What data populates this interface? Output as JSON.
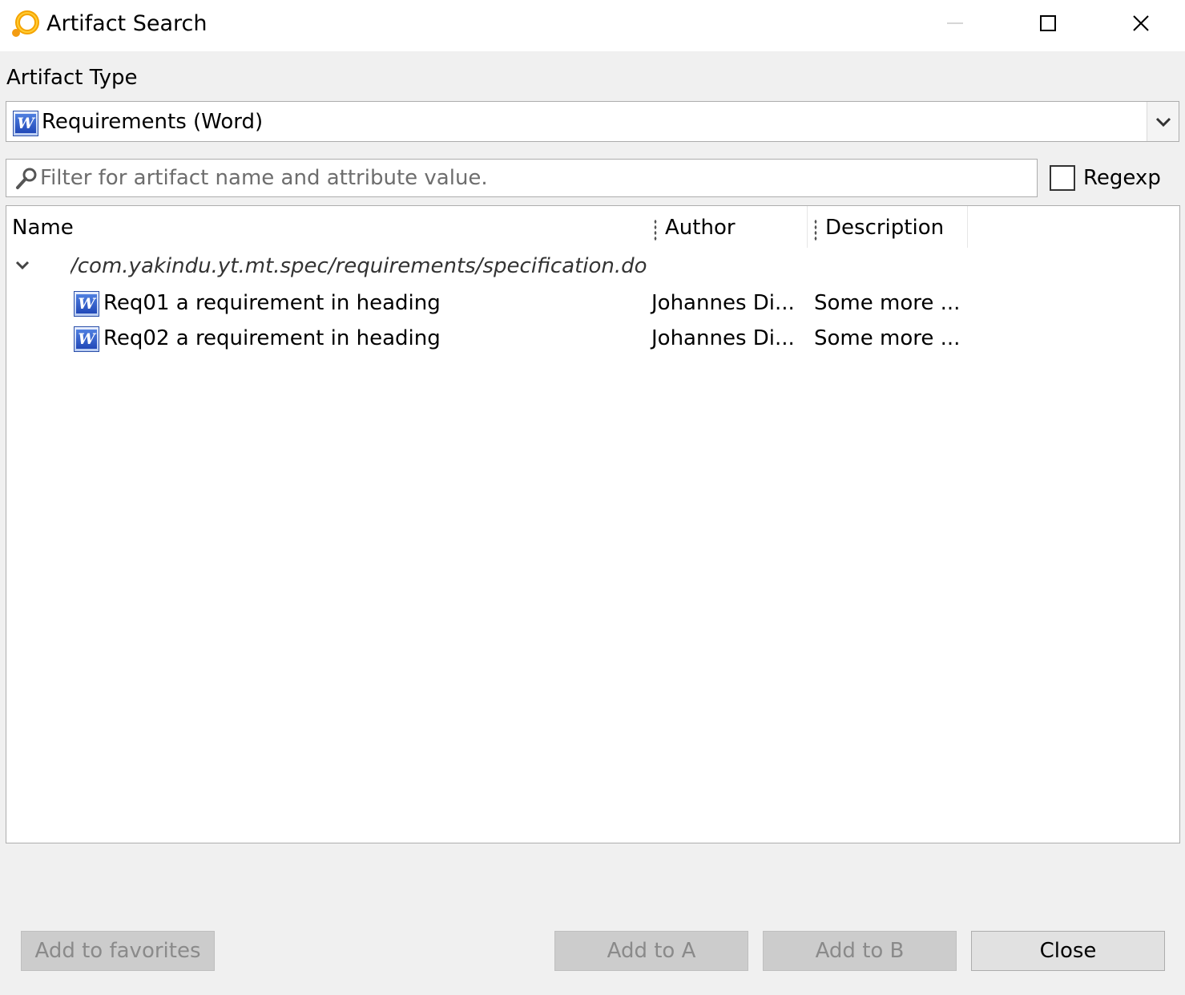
{
  "window": {
    "title": "Artifact Search",
    "icon": "yakindu-traceability-icon"
  },
  "artifact_type": {
    "label": "Artifact Type",
    "selected": "Requirements (Word)",
    "icon": "word-document-icon"
  },
  "filter": {
    "placeholder": "Filter for artifact name and attribute value.",
    "value": "",
    "regexp_label": "Regexp",
    "regexp_checked": false
  },
  "table": {
    "columns": [
      "Name",
      "Author",
      "Description"
    ],
    "group": {
      "path": "/com.yakindu.yt.mt.spec/requirements/specification.docx",
      "expanded": true
    },
    "rows": [
      {
        "name": "Req01 a requirement in heading",
        "author": "Johannes Di...",
        "description": "Some more ..."
      },
      {
        "name": "Req02 a requirement in heading",
        "author": "Johannes Di...",
        "description": "Some more ..."
      }
    ]
  },
  "buttons": {
    "add_favorites": "Add to favorites",
    "add_a": "Add to A",
    "add_b": "Add to B",
    "close": "Close"
  }
}
